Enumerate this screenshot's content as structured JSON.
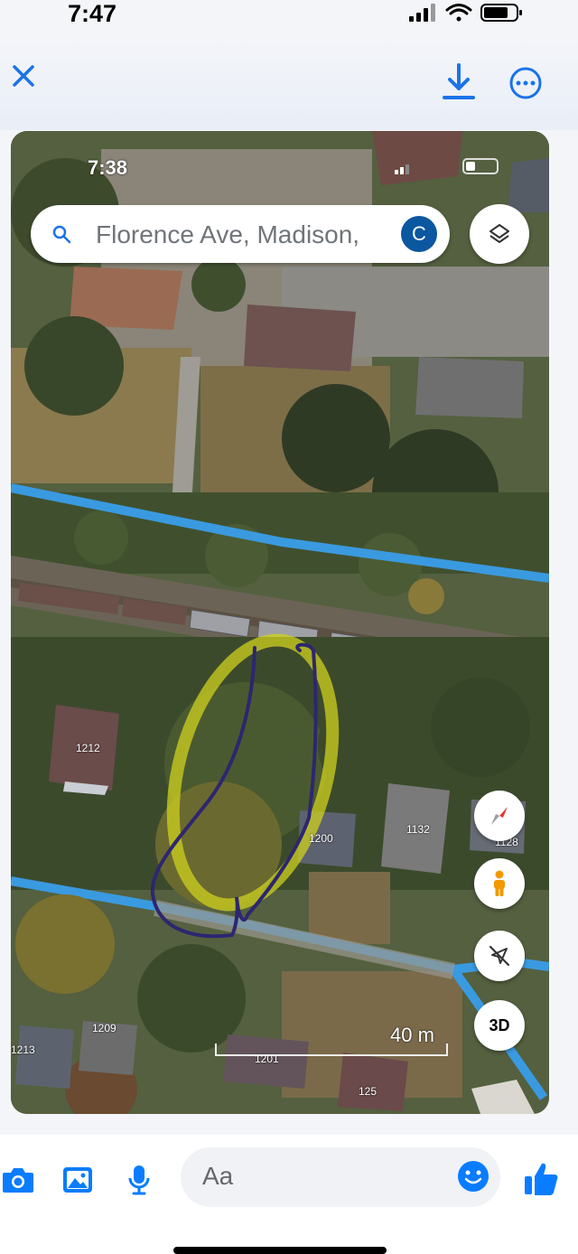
{
  "status_bar": {
    "time": "7:47"
  },
  "header": {
    "close": "close-icon",
    "download": "download-icon",
    "more": "more-options-icon",
    "accent": "#1a73e8"
  },
  "photo": {
    "inner_time": "7:38",
    "search": {
      "text": "Florence Ave, Madison,",
      "avatar_letter": "C"
    },
    "buttons": {
      "layers": "layers-icon",
      "compass": "compass-icon",
      "pegman": "pegman-icon",
      "navigate": "navigation-off-icon",
      "three_d": "3D"
    },
    "scale_label": "40 m",
    "house_numbers": [
      "1212",
      "1200",
      "1132",
      "1128",
      "1209",
      "1213",
      "1201",
      "125"
    ]
  },
  "composer": {
    "placeholder": "Aa",
    "icons": [
      "camera-icon",
      "gallery-icon",
      "microphone-icon",
      "emoji-icon",
      "thumbs-up-icon"
    ],
    "accent": "#0a7cff"
  }
}
